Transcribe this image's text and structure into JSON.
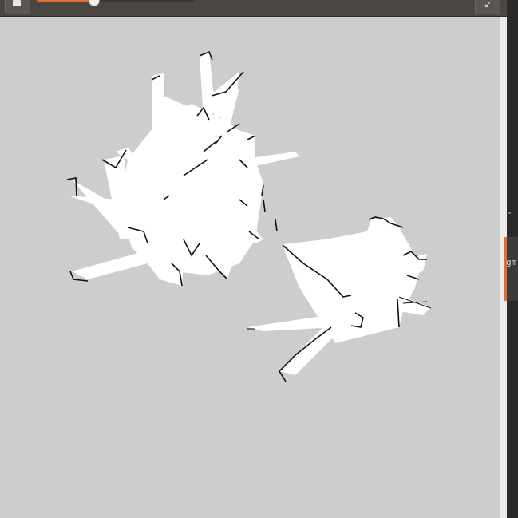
{
  "toolbar": {
    "left_icon": "save-icon",
    "right_icon": "collapse-icon",
    "right_glyph": "↙",
    "slider_value": 0.36
  },
  "side_window": {
    "label": "gm"
  },
  "colors": {
    "toolbar_bg": "#4a4743",
    "accent": "#e46c2d",
    "map_unknown": "#cdcdcd",
    "map_free": "#ffffff",
    "map_occupied": "#000000"
  }
}
